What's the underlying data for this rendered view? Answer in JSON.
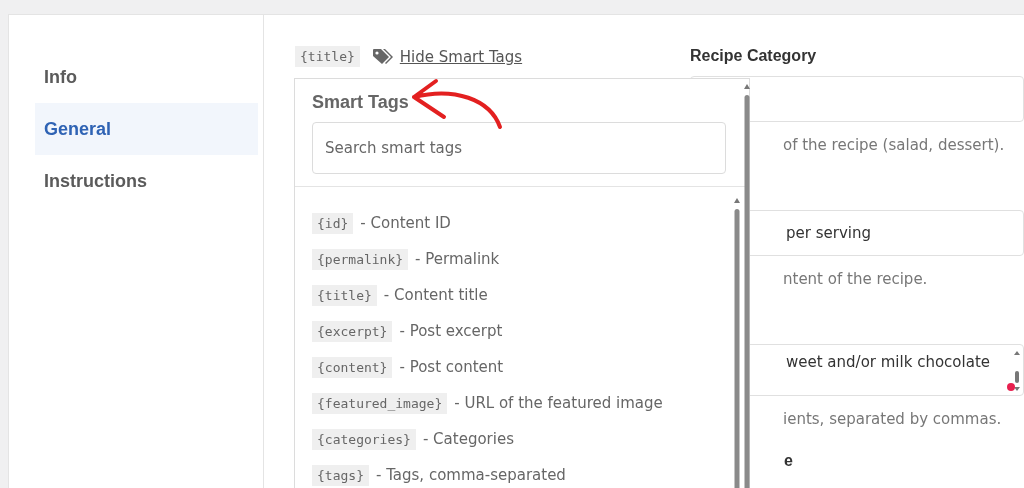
{
  "sidebar": {
    "items": [
      {
        "label": "Info",
        "selected": false
      },
      {
        "label": "General",
        "selected": true
      },
      {
        "label": "Instructions",
        "selected": false
      }
    ]
  },
  "title_field": {
    "tag": "{title}",
    "toggle": "Hide Smart Tags"
  },
  "smart_tags": {
    "title": "Smart Tags",
    "search": {
      "placeholder": "Search smart tags"
    },
    "tags": [
      {
        "tag": "{id}",
        "description": "- Content ID"
      },
      {
        "tag": "{permalink}",
        "description": "- Permalink"
      },
      {
        "tag": "{title}",
        "description": "- Content title"
      },
      {
        "tag": "{excerpt}",
        "description": "- Post excerpt"
      },
      {
        "tag": "{content}",
        "description": "- Post content"
      },
      {
        "tag": "{featured_image}",
        "description": "- URL of the featured image"
      },
      {
        "tag": "{categories}",
        "description": "- Categories"
      },
      {
        "tag": "{tags}",
        "description": "- Tags, comma-separated"
      }
    ]
  },
  "form": {
    "fields": [
      {
        "kind": "input",
        "label": "Recipe Category",
        "help": "of the recipe (salad, dessert)."
      },
      {
        "kind": "input",
        "value": "per serving",
        "help": "ntent of the recipe."
      },
      {
        "kind": "textarea",
        "value": "weet and/or milk chocolate",
        "help": "ients, separated by commas."
      },
      {
        "kind": "label",
        "label": "e"
      }
    ]
  }
}
